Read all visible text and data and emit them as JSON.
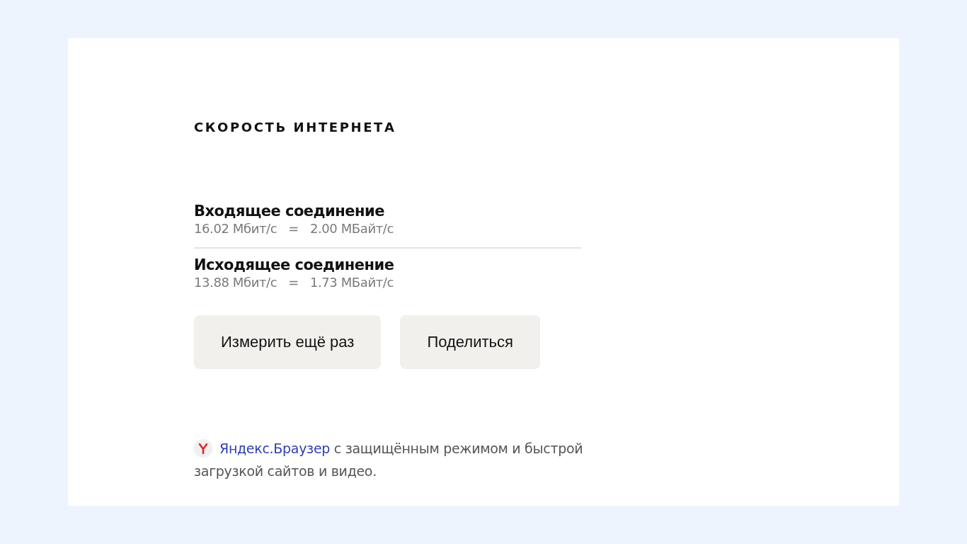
{
  "title": "СКОРОСТЬ ИНТЕРНЕТА",
  "connections": [
    {
      "label": "Входящее соединение",
      "mbits": "16.02 Мбит/с",
      "equals": "=",
      "mbytes": "2.00 МБайт/с"
    },
    {
      "label": "Исходящее соединение",
      "mbits": "13.88 Мбит/с",
      "equals": "=",
      "mbytes": "1.73 МБайт/с"
    }
  ],
  "buttons": [
    "Измерить ещё раз",
    "Поделиться"
  ],
  "promo": {
    "link": "Яндекс.Браузер",
    "text": " с защищённым режимом и быстрой загрузкой сайтов и видео."
  }
}
